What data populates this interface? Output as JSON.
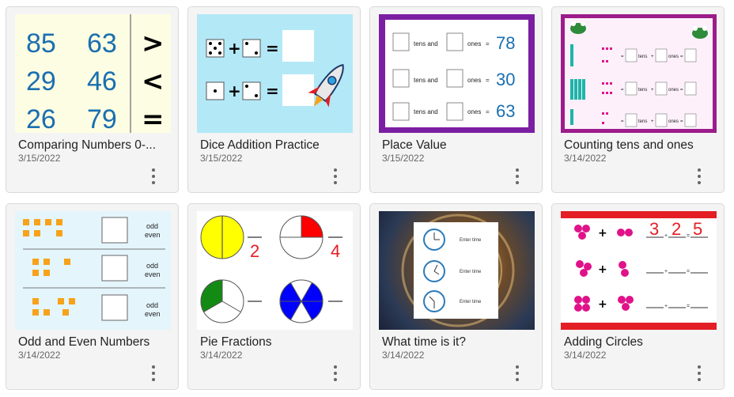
{
  "cards": [
    {
      "title": "Comparing Numbers 0-...",
      "date": "3/15/2022",
      "nums": [
        [
          "85",
          "63"
        ],
        [
          "29",
          "46"
        ],
        [
          "26",
          "79"
        ]
      ],
      "symbols": [
        ">",
        "<",
        "="
      ]
    },
    {
      "title": "Dice Addition Practice",
      "date": "3/15/2022",
      "plus": "+",
      "eq": "="
    },
    {
      "title": "Place Value",
      "date": "3/15/2022",
      "tens": "tens and",
      "ones": "ones",
      "eq": "=",
      "values": [
        "78",
        "30",
        "63"
      ]
    },
    {
      "title": "Counting tens and ones",
      "date": "3/14/2022",
      "tens": "tens",
      "ones": "ones",
      "plus": "+",
      "eq": "="
    },
    {
      "title": "Odd and Even Numbers",
      "date": "3/14/2022",
      "odd": "odd",
      "even": "even"
    },
    {
      "title": "Pie Fractions",
      "date": "3/14/2022",
      "fracs": [
        "2",
        "4"
      ]
    },
    {
      "title": "What time is it?",
      "date": "3/14/2022",
      "enter": "Enter time"
    },
    {
      "title": "Adding Circles",
      "date": "3/14/2022",
      "answers": [
        "3",
        "2",
        "5"
      ],
      "plus": "+",
      "eq": "="
    }
  ],
  "colors": {
    "blue_num": "#1a6fb0",
    "pink": "#e0128a",
    "orange": "#f7a21b",
    "red": "#e31e24",
    "purple": "#7b1fa2"
  }
}
